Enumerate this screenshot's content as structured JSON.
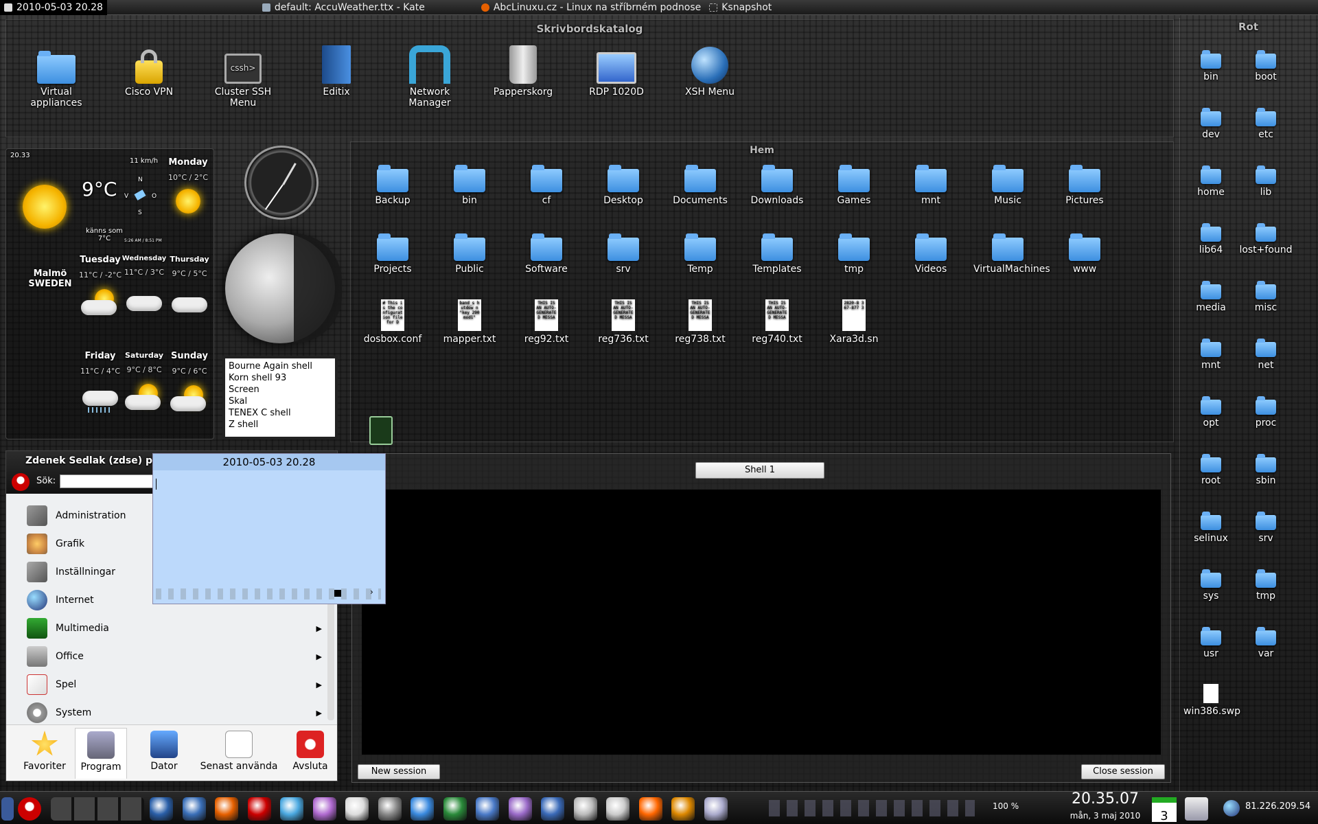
{
  "topbar": {
    "tasks": [
      "2010-05-03 20.28",
      "default: AccuWeather.ttx - Kate",
      "AbcLinuxu.cz - Linux na stříbrném podnose",
      "Ksnapshot"
    ]
  },
  "desktop_panel": {
    "title": "Skrivbordskatalog",
    "icons": [
      {
        "label": "Virtual appliances",
        "icon": "folder-icon"
      },
      {
        "label": "Cisco VPN",
        "icon": "lock-icon"
      },
      {
        "label": "Cluster SSH Menu",
        "icon": "ssh-terminal-icon"
      },
      {
        "label": "Editix",
        "icon": "book-icon"
      },
      {
        "label": "Network Manager",
        "icon": "network-manager-icon"
      },
      {
        "label": "Papperskorg",
        "icon": "trash-icon"
      },
      {
        "label": "RDP 1020D",
        "icon": "remote-desktop-icon"
      },
      {
        "label": "XSH Menu",
        "icon": "globe-icon"
      }
    ]
  },
  "hem": {
    "title": "Hem",
    "folders_row1": [
      "Backup",
      "bin",
      "cf",
      "Desktop",
      "Documents",
      "Downloads",
      "Games",
      "mnt",
      "Music",
      "Pictures"
    ],
    "folders_row2": [
      "Projects",
      "Public",
      "Software",
      "srv",
      "Temp",
      "Templates",
      "tmp",
      "Videos",
      "VirtualMachines",
      "www"
    ],
    "files": [
      {
        "name": "dosbox.conf",
        "preview": "# This is the configuration file for D"
      },
      {
        "name": "mapper.txt",
        "preview": "band_s hutdow n \"key 290 mod1\""
      },
      {
        "name": "reg92.txt",
        "preview": "THIS IS AN AUTO-GENERATED MESSA"
      },
      {
        "name": "reg736.txt",
        "preview": "THIS IS AN AUTO-GENERATED MESSA"
      },
      {
        "name": "reg738.txt",
        "preview": "THIS IS AN AUTO-GENERATED MESSA"
      },
      {
        "name": "reg740.txt",
        "preview": "THIS IS AN AUTO-GENERATED MESSA"
      },
      {
        "name": "Xara3d.sn",
        "preview": "2820-8 367-877 3"
      }
    ]
  },
  "weather": {
    "time": "20.33",
    "temp": "9°C",
    "wind": "11 km/h",
    "compass": {
      "n": "N",
      "v": "V",
      "o": "O",
      "s": "S"
    },
    "feels": "känns som",
    "feels_temp": "7°C",
    "update": "5:26 AM / 8:51 PM",
    "city": "Malmö",
    "country": "SWEDEN",
    "days": [
      {
        "name": "Monday",
        "temps": "10°C / 2°C"
      },
      {
        "name": "Tuesday",
        "temps": "11°C / -2°C"
      },
      {
        "name": "Wednesday",
        "temps": "11°C / 3°C"
      },
      {
        "name": "Thursday",
        "temps": "9°C / 5°C"
      },
      {
        "name": "Friday",
        "temps": "11°C / 4°C"
      },
      {
        "name": "Saturday",
        "temps": "9°C / 8°C"
      },
      {
        "name": "Sunday",
        "temps": "9°C / 6°C"
      }
    ]
  },
  "shells": [
    "Bourne Again shell",
    "Korn shell 93",
    "Screen",
    "Skal",
    "TENEX C shell",
    "Z shell"
  ],
  "menu": {
    "user": "Zdenek Sedlak (zdse) på",
    "search_label": "Sök:",
    "search_value": "",
    "items": [
      "Administration",
      "Grafik",
      "Inställningar",
      "Internet",
      "Multimedia",
      "Office",
      "Spel",
      "System"
    ],
    "tabs": [
      "Favoriter",
      "Program",
      "Dator",
      "Senast använda",
      "Avsluta"
    ]
  },
  "note": {
    "title": "2010-05-03 20.28"
  },
  "konsole": {
    "tab": "Shell 1",
    "new_session": "New session",
    "close_session": "Close session"
  },
  "rot": {
    "title": "Rot",
    "items": [
      "bin",
      "boot",
      "dev",
      "etc",
      "home",
      "lib",
      "lib64",
      "lost+found",
      "media",
      "misc",
      "mnt",
      "net",
      "opt",
      "proc",
      "root",
      "sbin",
      "selinux",
      "srv",
      "sys",
      "tmp",
      "usr",
      "var",
      "win386.swp"
    ]
  },
  "taskbar": {
    "volume": "100 %",
    "clock_time": "20.35.07",
    "clock_date": "mån, 3 maj 2010",
    "calendar_day": "3",
    "ip": "81.226.209.54"
  },
  "colors": {
    "folder": "#5aa8f0",
    "note_bg": "#bcd9fb",
    "terminal_bg": "#000000"
  }
}
